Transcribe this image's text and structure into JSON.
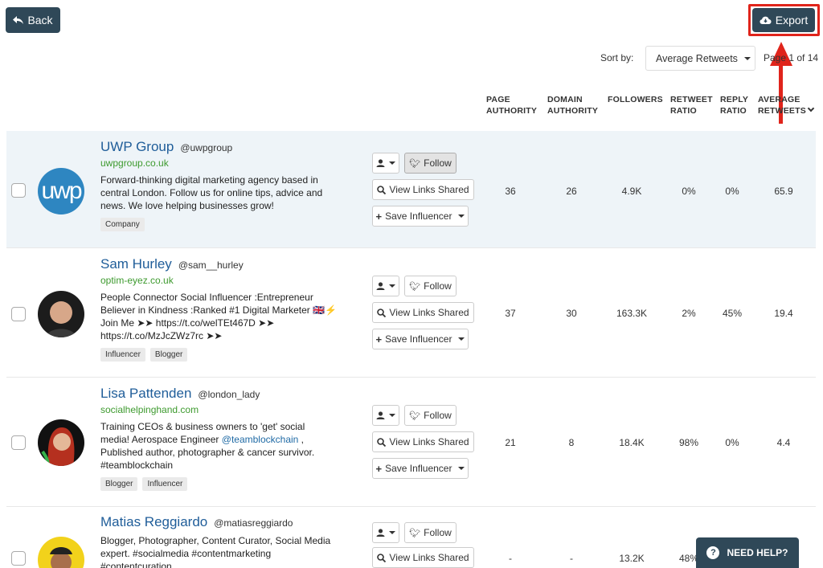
{
  "header": {
    "back_label": "Back",
    "export_label": "Export"
  },
  "sort": {
    "label": "Sort by:",
    "selected": "Average Retweets",
    "page_info": "Page 1 of 14"
  },
  "columns": [
    {
      "line1": "PAGE",
      "line2": "AUTHORITY"
    },
    {
      "line1": "DOMAIN",
      "line2": "AUTHORITY"
    },
    {
      "line1": "FOLLOWERS",
      "line2": ""
    },
    {
      "line1": "RETWEET",
      "line2": "RATIO"
    },
    {
      "line1": "REPLY",
      "line2": "RATIO"
    },
    {
      "line1": "AVERAGE",
      "line2": "RETWEETS"
    }
  ],
  "influencers": [
    {
      "name": "UWP Group",
      "handle": "@uwpgroup",
      "site": "uwpgroup.co.uk",
      "bio": "Forward-thinking digital marketing agency based in central London. Follow us for online tips, advice and news. We love helping businesses grow!",
      "tags": [
        "Company"
      ],
      "metrics": [
        "36",
        "26",
        "4.9K",
        "0%",
        "0%",
        "65.9"
      ]
    },
    {
      "name": "Sam Hurley",
      "handle": "@sam__hurley",
      "site": "optim-eyez.co.uk",
      "bio_line1": "People Connector  Social Influencer :Entrepreneur",
      "bio_line2": "Believer in Kindness :Ranked #1 Digital Marketer 🇬🇧⚡",
      "bio_line3": "Join Me ➤➤ https://t.co/welTEt467D ➤➤",
      "bio_line4": "https://t.co/MzJcZWz7rc ➤➤",
      "tags": [
        "Influencer",
        "Blogger"
      ],
      "metrics": [
        "37",
        "30",
        "163.3K",
        "2%",
        "45%",
        "19.4"
      ]
    },
    {
      "name": "Lisa Pattenden",
      "handle": "@london_lady",
      "site": "socialhelpinghand.com",
      "bio_pre": "Training CEOs & business owners to 'get' social media! Aerospace Engineer ",
      "bio_link": "@teamblockchain",
      "bio_post": " , Published author, photographer & cancer survivor. #teamblockchain",
      "tags": [
        "Blogger",
        "Influencer"
      ],
      "metrics": [
        "21",
        "8",
        "18.4K",
        "98%",
        "0%",
        "4.4"
      ]
    },
    {
      "name": "Matias Reggiardo",
      "handle": "@matiasreggiardo",
      "site": "",
      "bio": "Blogger, Photographer, Content Curator, Social Media expert. #socialmedia #contentmarketing #contentcuration",
      "tags": [],
      "metrics": [
        "-",
        "-",
        "13.2K",
        "48%",
        "",
        ""
      ]
    }
  ],
  "actions": {
    "follow_label": "Follow",
    "links_label": "View Links Shared",
    "save_label": "Save Influencer"
  },
  "help": {
    "label": "NEED HELP?"
  },
  "avatar_text": {
    "uwp": "uwp"
  },
  "colors": {
    "primary": "#2f4858",
    "link": "#1f5d99",
    "site": "#3d9a2e",
    "highlight": "#e0241b"
  }
}
